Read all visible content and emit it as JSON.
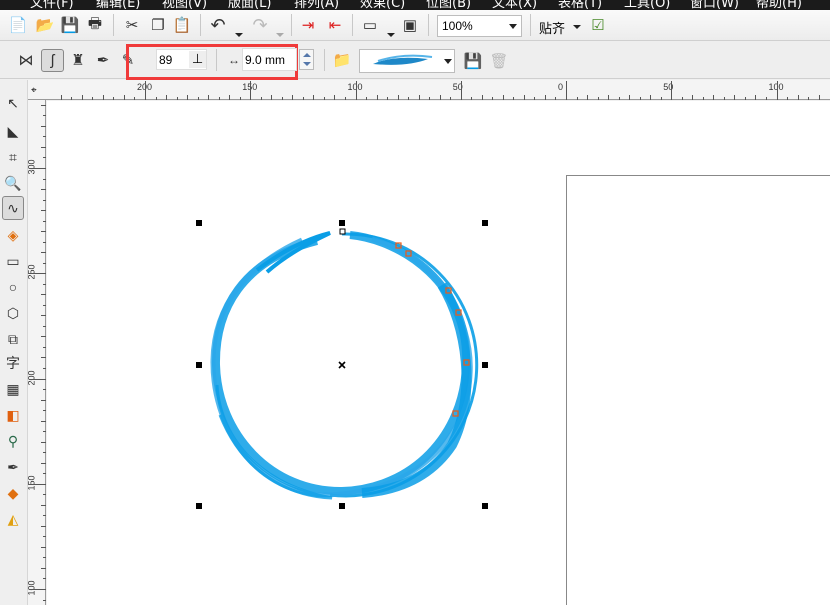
{
  "menu": [
    "文件(F)",
    "编辑(E)",
    "视图(V)",
    "版面(L)",
    "排列(A)",
    "效果(C)",
    "位图(B)",
    "文本(X)",
    "表格(T)",
    "工具(O)",
    "窗口(W)",
    "帮助(H)"
  ],
  "standard_toolbar": {
    "zoom_value": "100%",
    "snap_label": "贴齐"
  },
  "property_bar": {
    "angle_value": "89",
    "width_value": "9.0 mm",
    "highlight_color": "#f03a3a"
  },
  "rulers": {
    "top_labels": [
      "200",
      "150",
      "100",
      "50",
      "0",
      "50",
      "100"
    ],
    "left_labels": [
      "300",
      "250",
      "200",
      "150",
      "100"
    ]
  },
  "colors": {
    "stroke": "#0a9ee6",
    "node": "#f05a14",
    "accent_highlight": "#f03a3a"
  }
}
